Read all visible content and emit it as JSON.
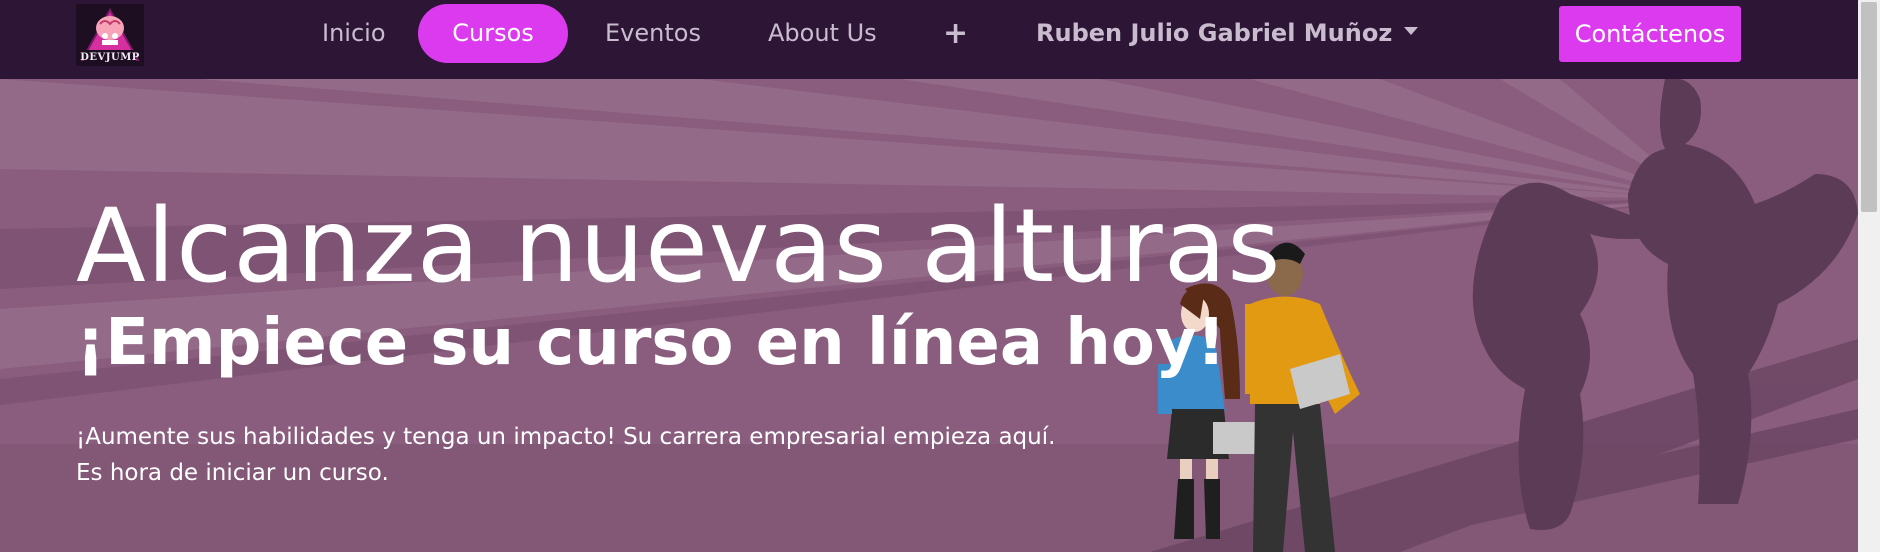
{
  "brand": {
    "logo_text": "DEVJUMP"
  },
  "nav": {
    "items": [
      {
        "label": "Inicio",
        "active": false
      },
      {
        "label": "Cursos",
        "active": true
      },
      {
        "label": "Eventos",
        "active": false
      },
      {
        "label": "About Us",
        "active": false
      }
    ],
    "plus_label": "+",
    "user_name": "Ruben Julio Gabriel Muñoz",
    "contact_label": "Contáctenos"
  },
  "hero": {
    "title": "Alcanza nuevas alturas",
    "subtitle": "¡Empiece su curso en línea hoy!",
    "line1": "¡Aumente sus habilidades y tenga un impacto! Su carrera empresarial empieza aquí.",
    "line2": "Es hora de iniciar un curso."
  },
  "colors": {
    "navbar_bg": "#2c1535",
    "accent": "#dc3aee",
    "hero_bg": "#8a5d7e",
    "silhouette": "#5b3b55"
  },
  "icons": {
    "plus": "plus-icon",
    "caret": "chevron-down-icon",
    "logo": "devjump-logo"
  }
}
